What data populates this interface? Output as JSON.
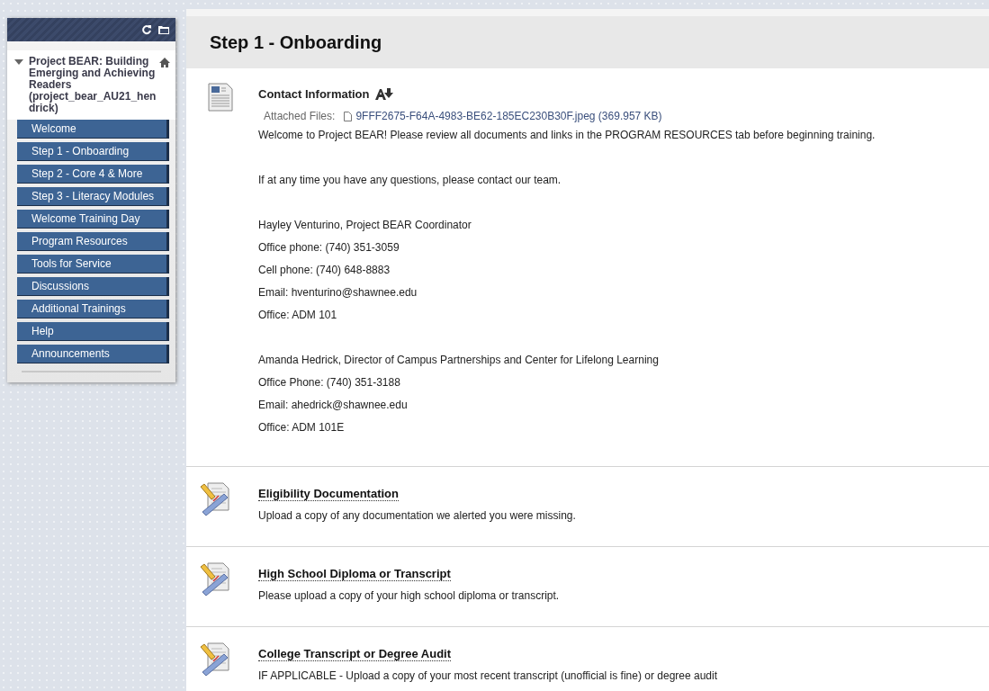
{
  "course_menu": {
    "course_title": "Project BEAR: Building Emerging and Achieving Readers (project_bear_AU21_hendrick)",
    "expanded": true,
    "items": [
      {
        "label": "Welcome"
      },
      {
        "label": "Step 1 - Onboarding"
      },
      {
        "label": "Step 2 - Core 4 & More"
      },
      {
        "label": "Step 3 - Literacy Modules"
      },
      {
        "label": "Welcome Training Day"
      },
      {
        "label": "Program Resources"
      },
      {
        "label": "Tools for Service"
      },
      {
        "label": "Discussions"
      },
      {
        "label": "Additional Trainings"
      },
      {
        "label": "Help"
      },
      {
        "label": "Announcements"
      }
    ]
  },
  "page_title": "Step 1 - Onboarding",
  "content_items": [
    {
      "kind": "document",
      "title": "Contact Information",
      "attachment_label": "Attached Files:",
      "attachment": "9FFF2675-F64A-4983-BE62-185EC230B30F.jpeg (369.957 KB)",
      "paragraphs": [
        [
          "Welcome to Project BEAR! Please review all documents and links in the PROGRAM RESOURCES tab before beginning training."
        ],
        [
          "If at any time you have any questions, please contact our team."
        ],
        [
          "Hayley Venturino, Project BEAR Coordinator",
          "Office phone: (740) 351-3059",
          "Cell phone: (740) 648-8883",
          "Email: hventurino@shawnee.edu",
          "Office: ADM 101"
        ],
        [
          "Amanda Hedrick, Director of Campus Partnerships and Center for Lifelong Learning",
          "Office Phone:  (740) 351-3188",
          "Email:  ahedrick@shawnee.edu",
          "Office: ADM 101E"
        ]
      ]
    },
    {
      "kind": "assignment",
      "title": "Eligibility Documentation",
      "paragraphs": [
        [
          "Upload a copy of any documentation we alerted you were missing."
        ]
      ]
    },
    {
      "kind": "assignment",
      "title": "High School Diploma or Transcript",
      "paragraphs": [
        [
          "Please upload a copy of your high school diploma or transcript."
        ]
      ]
    },
    {
      "kind": "assignment",
      "title": "College Transcript or Degree Audit",
      "paragraphs": [
        [
          "IF APPLICABLE - Upload a copy of your most recent transcript (unofficial is fine) or degree audit"
        ]
      ]
    }
  ]
}
